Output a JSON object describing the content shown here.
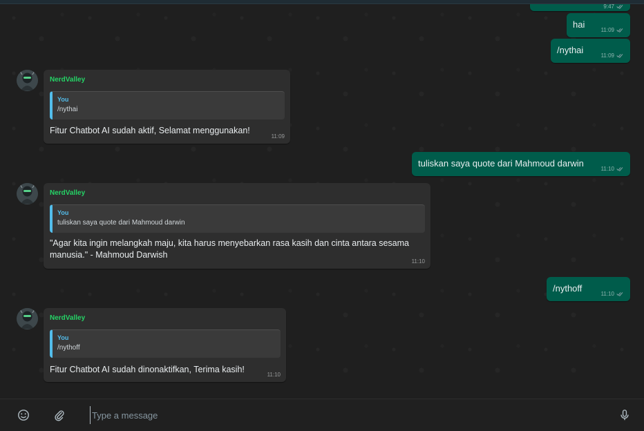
{
  "outgoing": [
    {
      "id": "m0",
      "text": "",
      "time": "9:47"
    },
    {
      "id": "m1",
      "text": "hai",
      "time": "11:09"
    },
    {
      "id": "m2",
      "text": "/nythai",
      "time": "11:09"
    },
    {
      "id": "m3",
      "text": "tuliskan saya quote dari Mahmoud darwin",
      "time": "11:10"
    },
    {
      "id": "m4",
      "text": "/nythoff",
      "time": "11:10"
    }
  ],
  "incoming": [
    {
      "sender": "NerdValley",
      "quote_author": "You",
      "quote_text": "/nythai",
      "body": "Fitur Chatbot AI sudah aktif, Selamat menggunakan!",
      "time": "11:09"
    },
    {
      "sender": "NerdValley",
      "quote_author": "You",
      "quote_text": "tuliskan saya quote dari Mahmoud darwin",
      "body": "\"Agar kita ingin melangkah maju, kita harus menyebarkan rasa kasih dan cinta antara sesama manusia.\" - Mahmoud Darwish",
      "time": "11:10"
    },
    {
      "sender": "NerdValley",
      "quote_author": "You",
      "quote_text": "/nythoff",
      "body": "Fitur Chatbot AI sudah dinonaktifkan, Terima kasih!",
      "time": "11:10"
    }
  ],
  "composer": {
    "placeholder": "Type a message",
    "icons": [
      "emoji-icon",
      "attach-icon",
      "microphone-icon"
    ]
  },
  "colors": {
    "outgoing_bubble": "#005c4b",
    "incoming_bubble": "#2e2e2e",
    "sender_name": "#25d366",
    "quote_accent": "#53bdeb",
    "chat_background": "#1f1f1f"
  }
}
